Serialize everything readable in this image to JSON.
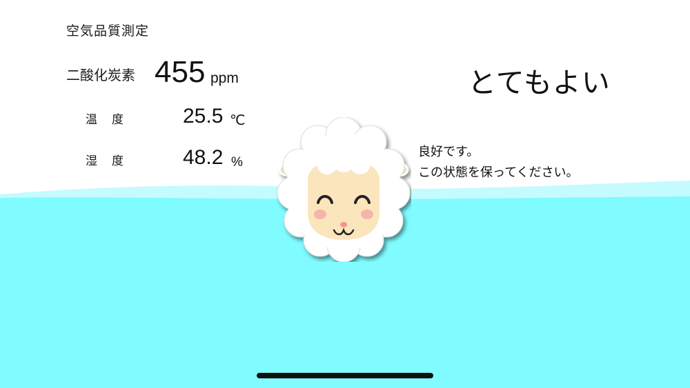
{
  "app": {
    "title": "空気品質測定"
  },
  "measurements": {
    "co2": {
      "label": "二酸化炭素",
      "value": "455",
      "unit": "ppm"
    },
    "temperature": {
      "label": "温　度",
      "value": "25.5",
      "unit": "℃"
    },
    "humidity": {
      "label": "湿　度",
      "value": "48.2",
      "unit": "%"
    }
  },
  "status": {
    "label": "とてもよい",
    "message_line1": "良好です。",
    "message_line2": "この状態を保ってください。",
    "level_color": "#80fbff",
    "mascot_icon": "smiling-sheep-icon"
  },
  "colors": {
    "water": "#80fbff",
    "water_back": "#c4fbff",
    "background": "#ffffff"
  }
}
